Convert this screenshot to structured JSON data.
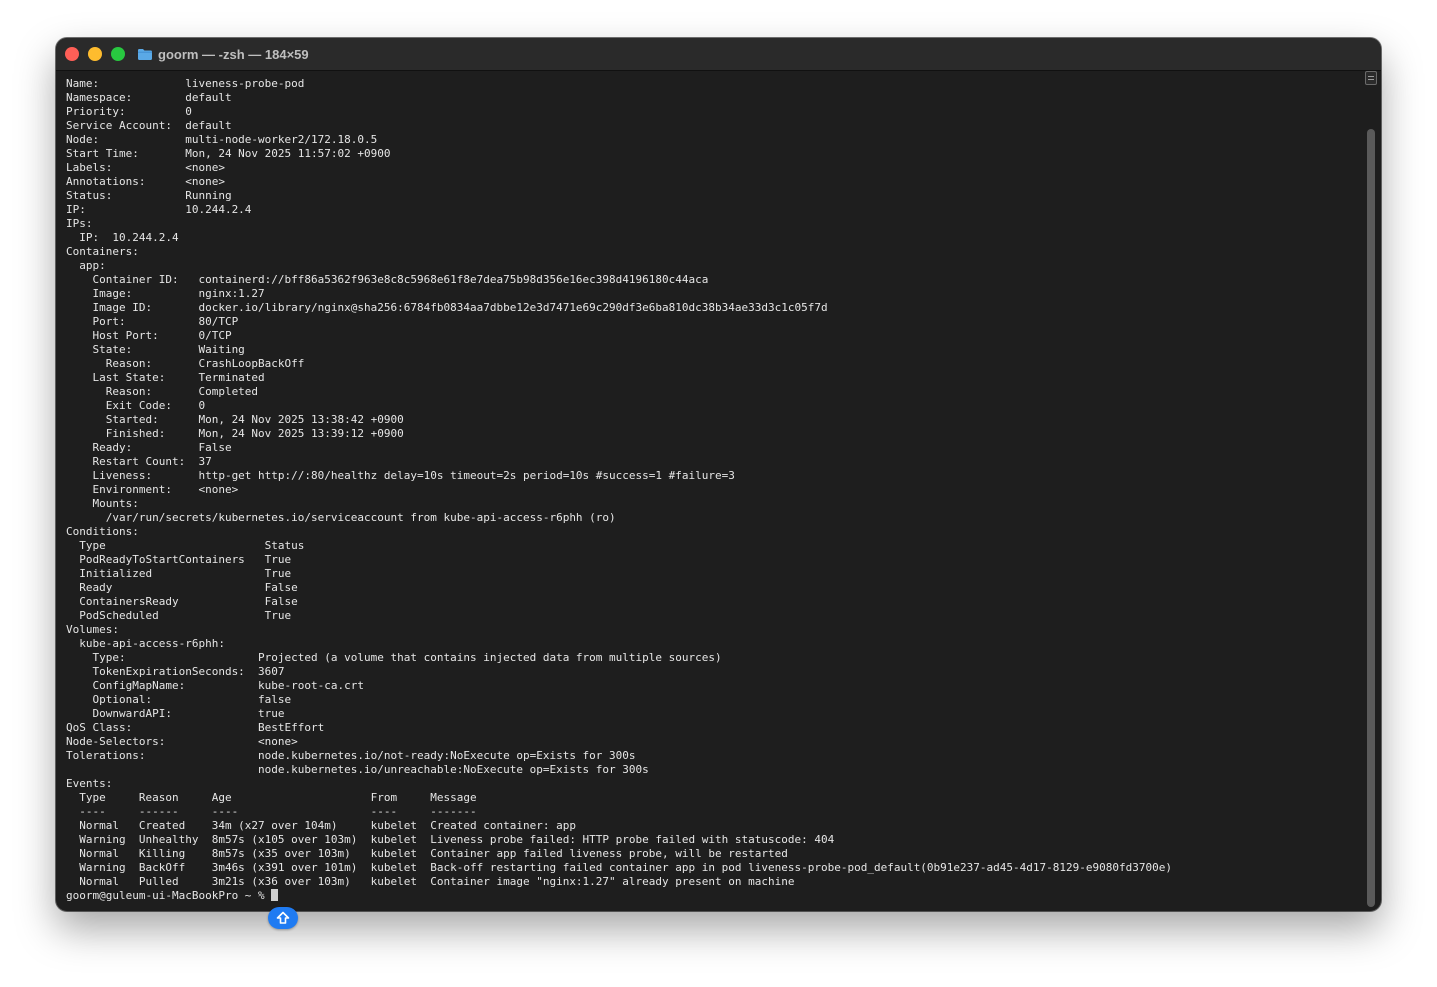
{
  "window": {
    "title": "goorm — -zsh — 184×59"
  },
  "terminal": {
    "lines": [
      "Name:             liveness-probe-pod",
      "Namespace:        default",
      "Priority:         0",
      "Service Account:  default",
      "Node:             multi-node-worker2/172.18.0.5",
      "Start Time:       Mon, 24 Nov 2025 11:57:02 +0900",
      "Labels:           <none>",
      "Annotations:      <none>",
      "Status:           Running",
      "IP:               10.244.2.4",
      "IPs:",
      "  IP:  10.244.2.4",
      "Containers:",
      "  app:",
      "    Container ID:   containerd://bff86a5362f963e8c8c5968e61f8e7dea75b98d356e16ec398d4196180c44aca",
      "    Image:          nginx:1.27",
      "    Image ID:       docker.io/library/nginx@sha256:6784fb0834aa7dbbe12e3d7471e69c290df3e6ba810dc38b34ae33d3c1c05f7d",
      "    Port:           80/TCP",
      "    Host Port:      0/TCP",
      "    State:          Waiting",
      "      Reason:       CrashLoopBackOff",
      "    Last State:     Terminated",
      "      Reason:       Completed",
      "      Exit Code:    0",
      "      Started:      Mon, 24 Nov 2025 13:38:42 +0900",
      "      Finished:     Mon, 24 Nov 2025 13:39:12 +0900",
      "    Ready:          False",
      "    Restart Count:  37",
      "    Liveness:       http-get http://:80/healthz delay=10s timeout=2s period=10s #success=1 #failure=3",
      "    Environment:    <none>",
      "    Mounts:",
      "      /var/run/secrets/kubernetes.io/serviceaccount from kube-api-access-r6phh (ro)",
      "Conditions:",
      "  Type                        Status",
      "  PodReadyToStartContainers   True",
      "  Initialized                 True",
      "  Ready                       False",
      "  ContainersReady             False",
      "  PodScheduled                True",
      "Volumes:",
      "  kube-api-access-r6phh:",
      "    Type:                    Projected (a volume that contains injected data from multiple sources)",
      "    TokenExpirationSeconds:  3607",
      "    ConfigMapName:           kube-root-ca.crt",
      "    Optional:                false",
      "    DownwardAPI:             true",
      "QoS Class:                   BestEffort",
      "Node-Selectors:              <none>",
      "Tolerations:                 node.kubernetes.io/not-ready:NoExecute op=Exists for 300s",
      "                             node.kubernetes.io/unreachable:NoExecute op=Exists for 300s",
      "Events:",
      "  Type     Reason     Age                     From     Message",
      "  ----     ------     ----                    ----     -------",
      "  Normal   Created    34m (x27 over 104m)     kubelet  Created container: app",
      "  Warning  Unhealthy  8m57s (x105 over 103m)  kubelet  Liveness probe failed: HTTP probe failed with statuscode: 404",
      "  Normal   Killing    8m57s (x35 over 103m)   kubelet  Container app failed liveness probe, will be restarted",
      "  Warning  BackOff    3m46s (x391 over 101m)  kubelet  Back-off restarting failed container app in pod liveness-probe-pod_default(0b91e237-ad45-4d17-8129-e9080fd3700e)",
      "  Normal   Pulled     3m21s (x36 over 103m)   kubelet  Container image \"nginx:1.27\" already present on machine"
    ],
    "prompt": "goorm@guleum-ui-MacBookPro ~ % "
  },
  "icons": {
    "folder": "folder-icon",
    "badge": "shift-up-arrow-icon"
  },
  "colors": {
    "background": "#1e1e1e",
    "text": "#e6e6e6",
    "close": "#ff5f57",
    "minimize": "#febc2e",
    "maximize": "#28c840",
    "folder": "#5aa9e6",
    "badge": "#1f7bf2"
  }
}
